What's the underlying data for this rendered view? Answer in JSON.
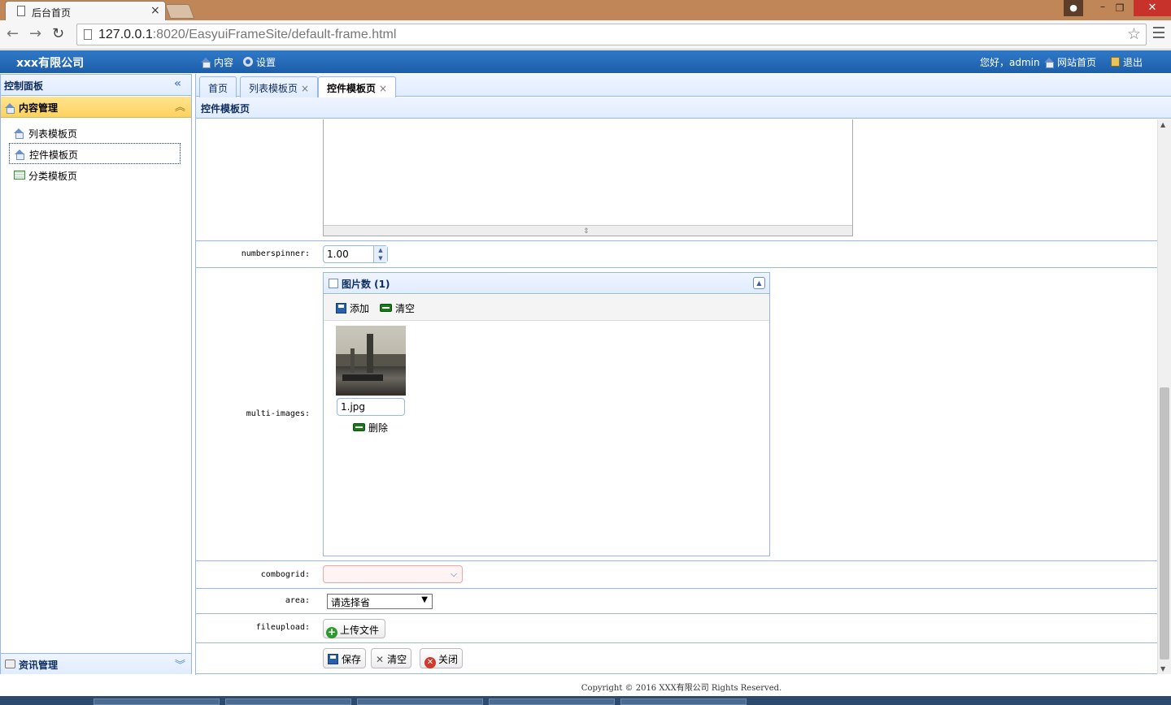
{
  "browser": {
    "tab_title": "后台首页",
    "tab_close": "×",
    "url_host": "127.0.0.1",
    "url_rest": ":8020/EasyuiFrameSite/default-frame.html"
  },
  "header": {
    "company": "xxx有限公司",
    "menu_content": "内容",
    "menu_settings": "设置",
    "greeting": "您好，admin",
    "site_home": "网站首页",
    "logout": "退出"
  },
  "sidebar": {
    "title": "控制面板",
    "section1_title": "内容管理",
    "items": [
      {
        "label": "列表模板页",
        "icon": "house-icon"
      },
      {
        "label": "控件模板页",
        "icon": "house-icon",
        "selected": true
      },
      {
        "label": "分类模板页",
        "icon": "grid-icon"
      }
    ],
    "section2_title": "资讯管理"
  },
  "tabs": [
    {
      "label": "首页",
      "closable": false
    },
    {
      "label": "列表模板页",
      "closable": true
    },
    {
      "label": "控件模板页",
      "closable": true,
      "active": true
    }
  ],
  "panel": {
    "title": "控件模板页"
  },
  "form": {
    "numberspinner_label": "numberspinner:",
    "numberspinner_value": "1.00",
    "multi_images_label": "multi-images:",
    "images_panel_title": "图片数 (1)",
    "add_label": "添加",
    "clear_label": "清空",
    "image_filename": "1.jpg",
    "delete_label": "删除",
    "combogrid_label": "combogrid:",
    "area_label": "area:",
    "area_value": "请选择省",
    "fileupload_label": "fileupload:",
    "upload_label": "上传文件",
    "save_label": "保存",
    "reset_label": "清空",
    "close_label": "关闭"
  },
  "footer": {
    "copyright": "Copyright © 2016 XXX有限公司 Rights Reserved."
  },
  "colors": {
    "header_blue": "#1d5ea8",
    "panel_border": "#95b8e7",
    "accordion_active": "#ffd25f",
    "browser_frame": "#c08658"
  }
}
